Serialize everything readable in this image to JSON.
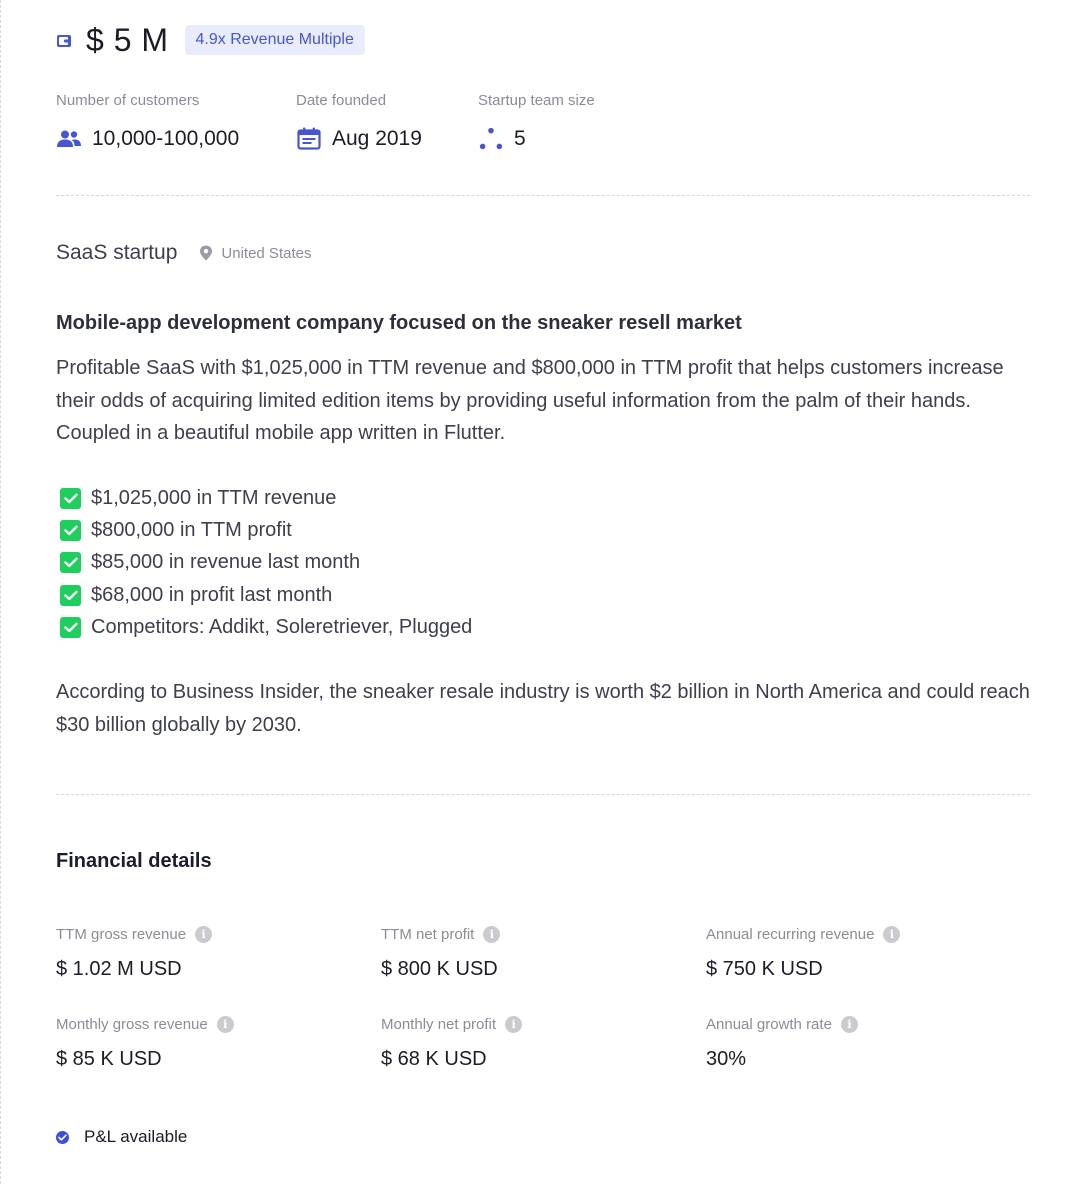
{
  "header": {
    "price": "$ 5 M",
    "multiple_badge": "4.9x Revenue Multiple"
  },
  "stats": [
    {
      "label": "Number of customers",
      "value": "10,000-100,000",
      "icon": "users-icon"
    },
    {
      "label": "Date founded",
      "value": "Aug 2019",
      "icon": "calendar-icon"
    },
    {
      "label": "Startup team size",
      "value": "5",
      "icon": "team-dots-icon"
    }
  ],
  "listing": {
    "type": "SaaS startup",
    "location": "United States",
    "headline": "Mobile-app development company focused on the sneaker resell market",
    "description": "Profitable SaaS with $1,025,000 in TTM revenue and $800,000 in TTM profit that helps customers increase their odds of acquiring limited edition items by providing useful information from the palm of their hands. Coupled in a beautiful mobile app written in Flutter.",
    "highlights": [
      "$1,025,000 in TTM revenue",
      "$800,000 in TTM profit",
      "$85,000 in revenue last month",
      "$68,000 in profit last month",
      "Competitors: Addikt, Soleretriever, Plugged"
    ],
    "closing": "According to Business Insider, the sneaker resale industry is worth $2 billion in North America and could reach $30 billion globally by 2030."
  },
  "financials": {
    "title": "Financial details",
    "metrics": [
      {
        "label": "TTM gross revenue",
        "value": "$ 1.02 M USD"
      },
      {
        "label": "TTM net profit",
        "value": "$ 800 K USD"
      },
      {
        "label": "Annual recurring revenue",
        "value": "$ 750 K USD"
      },
      {
        "label": "Monthly gross revenue",
        "value": "$ 85 K USD"
      },
      {
        "label": "Monthly net profit",
        "value": "$ 68 K USD"
      },
      {
        "label": "Annual growth rate",
        "value": "30%"
      }
    ],
    "pl_label": "P&L available"
  },
  "colors": {
    "accent": "#4656d2",
    "badge_bg": "#e9ecfc",
    "check_green": "#1fcf5e",
    "muted_text": "#8a8c96"
  }
}
